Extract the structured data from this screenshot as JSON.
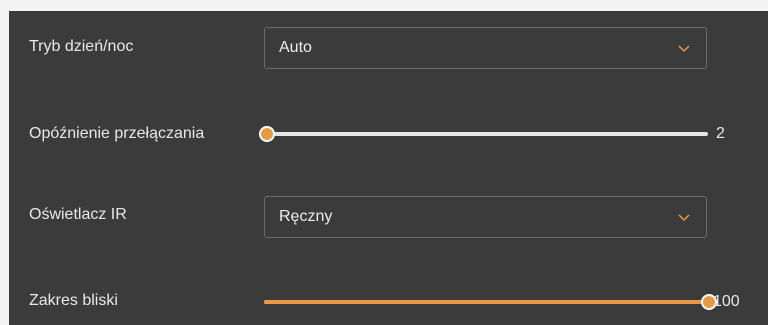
{
  "day_night": {
    "label": "Tryb dzień/noc",
    "value": "Auto",
    "icon": "chevron-down-icon"
  },
  "switch_delay": {
    "label": "Opóźnienie przełączania",
    "value": "2",
    "level": 0
  },
  "ir_illuminator": {
    "label": "Oświetlacz IR",
    "value": "Ręczny",
    "icon": "chevron-down-icon"
  },
  "near_range": {
    "label": "Zakres bliski",
    "value": "100",
    "level": 1
  },
  "colors": {
    "panel_bg": "#3b3b3b",
    "accent": "#e69a47",
    "track": "#e6e6e6",
    "text": "#e8e8e8"
  }
}
